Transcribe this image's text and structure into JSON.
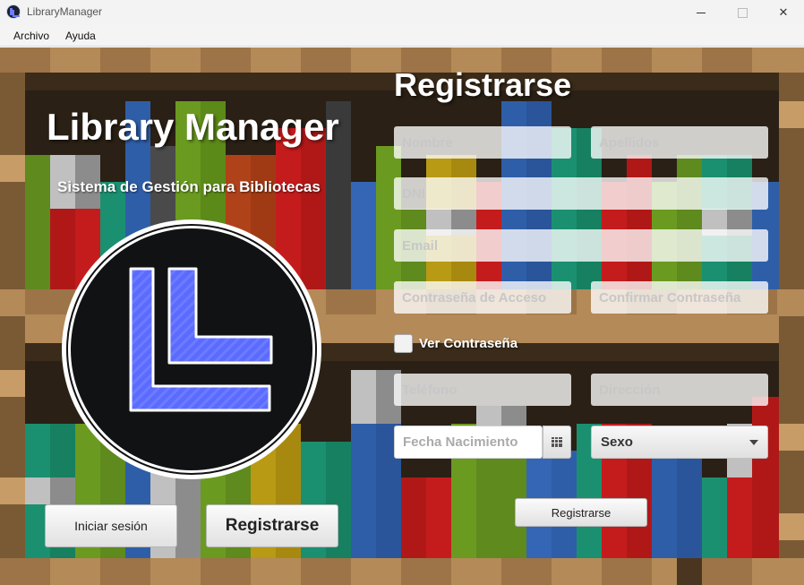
{
  "window": {
    "title": "LibraryManager"
  },
  "menu": {
    "items": [
      "Archivo",
      "Ayuda"
    ]
  },
  "brand": {
    "title": "Library Manager",
    "subtitle": "Sistema de Gestión para Bibliotecas"
  },
  "left_buttons": {
    "login": "Iniciar sesión",
    "register": "Registrarse"
  },
  "form": {
    "title": "Registrarse",
    "fields": {
      "nombre": "Nombre",
      "apellidos": "Apellidos",
      "dni": "DNI",
      "email": "Email",
      "password": "Contraseña de Acceso",
      "confirm_password": "Confirmar Contraseña",
      "telefono": "Teléfono",
      "direccion": "Dirección",
      "fecha_nacimiento": "Fecha Nacimiento"
    },
    "show_password_label": "Ver Contraseña",
    "show_password_checked": false,
    "sexo": {
      "selected": "Sexo"
    },
    "submit": "Registrarse"
  },
  "colors": {
    "wood_light": "#b48a58",
    "wood_dark": "#4a3620",
    "shelf_back": "#2a2015",
    "logo_accent": "#5b6bff"
  },
  "icons": [
    "app-icon",
    "calendar-icon",
    "chevron-down-icon",
    "library-logo"
  ]
}
